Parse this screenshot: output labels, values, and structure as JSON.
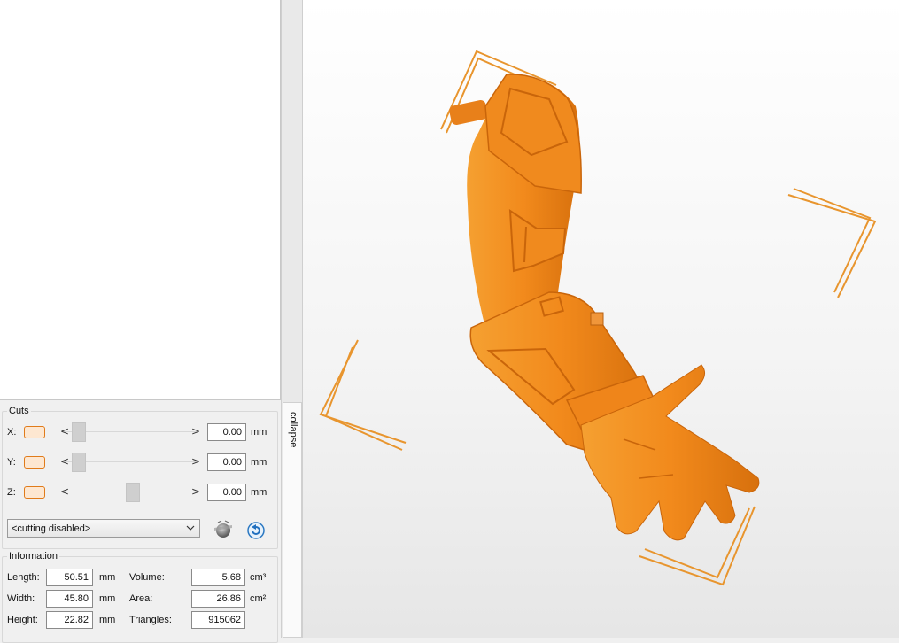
{
  "cuts": {
    "title": "Cuts",
    "axes": [
      {
        "label": "X:",
        "value": "0.00",
        "unit": "mm",
        "slider_position": 0.1
      },
      {
        "label": "Y:",
        "value": "0.00",
        "unit": "mm",
        "slider_position": 0.1
      },
      {
        "label": "Z:",
        "value": "0.00",
        "unit": "mm",
        "slider_position": 0.52
      }
    ],
    "mode_select": {
      "selected": "<cutting disabled>"
    },
    "arrow_left": "<",
    "arrow_right": ">"
  },
  "information": {
    "title": "Information",
    "length": {
      "label": "Length:",
      "value": "50.51",
      "unit": "mm"
    },
    "width": {
      "label": "Width:",
      "value": "45.80",
      "unit": "mm"
    },
    "height": {
      "label": "Height:",
      "value": "22.82",
      "unit": "mm"
    },
    "volume": {
      "label": "Volume:",
      "value": "5.68",
      "unit": "cm³"
    },
    "area": {
      "label": "Area:",
      "value": "26.86",
      "unit": "cm²"
    },
    "triangles": {
      "label": "Triangles:",
      "value": "915062"
    }
  },
  "collapse": {
    "label": "collapse"
  },
  "colors": {
    "model": "#f28a1c",
    "model_dark": "#c9650a",
    "selection": "#e8952e",
    "swatch_border": "#e07b1a"
  },
  "icons": {
    "plane": "cut-plane-icon",
    "reset": "reset-rotate-icon",
    "chevron": "chevron-down-icon"
  }
}
